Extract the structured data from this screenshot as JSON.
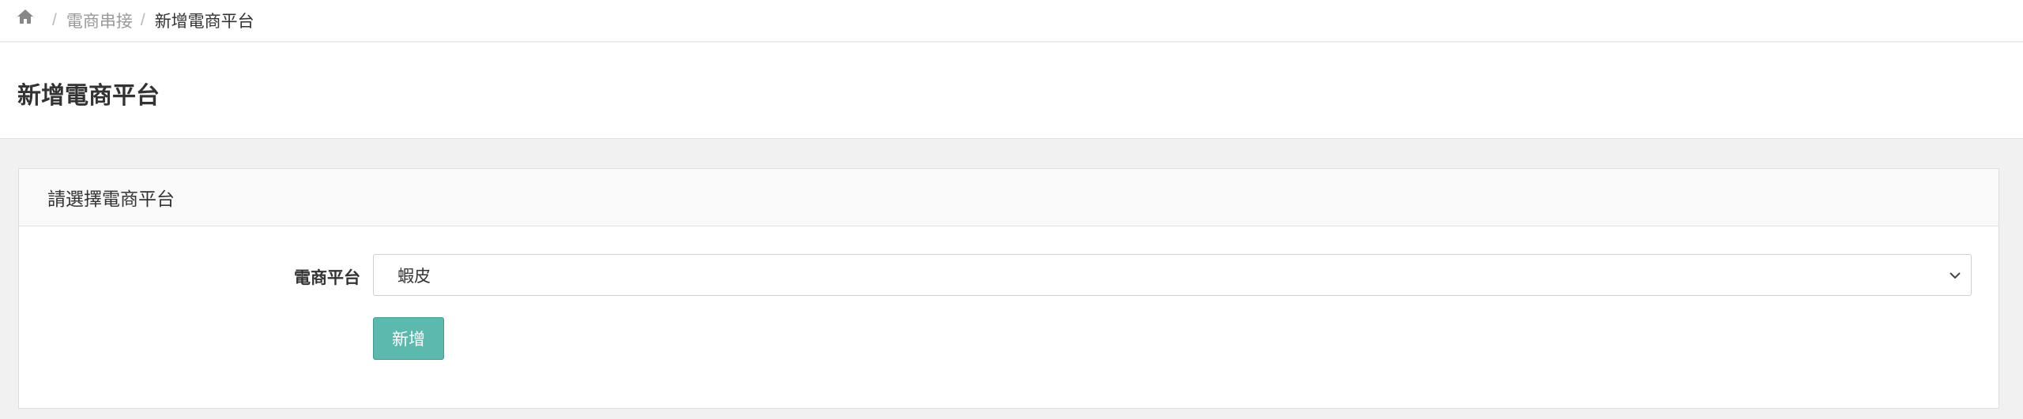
{
  "breadcrumb": {
    "home_icon": "home-icon",
    "separator": "/",
    "items": [
      "電商串接",
      "新增電商平台"
    ]
  },
  "page": {
    "title": "新增電商平台"
  },
  "panel": {
    "heading": "請選擇電商平台",
    "platform_label": "電商平台",
    "platform_selected": "蝦皮",
    "submit_label": "新增"
  },
  "colors": {
    "button_bg": "#5bb9ae",
    "page_bg": "#f1f1f1"
  }
}
